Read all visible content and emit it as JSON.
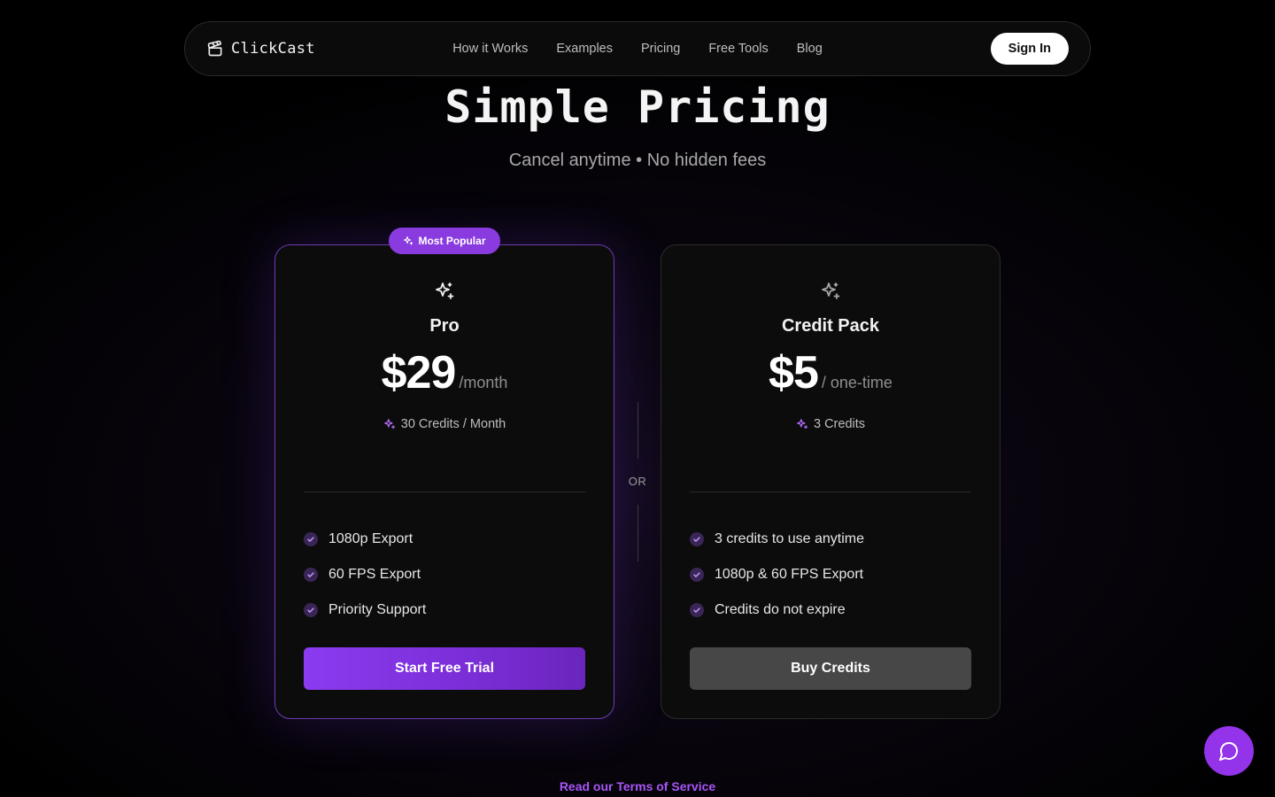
{
  "nav": {
    "brand": "ClickCast",
    "brand_icon": "clapperboard-icon",
    "links": [
      "How it Works",
      "Examples",
      "Pricing",
      "Free Tools",
      "Blog"
    ],
    "signin_label": "Sign In"
  },
  "hero": {
    "title": "Simple Pricing",
    "subtitle": "Cancel anytime • No hidden fees"
  },
  "plans": [
    {
      "badge": "Most Popular",
      "icon": "sparkles-icon",
      "name": "Pro",
      "price": "$29",
      "period": "/month",
      "credits": "30 Credits / Month",
      "features": [
        "1080p Export",
        "60 FPS Export",
        "Priority Support"
      ],
      "cta": "Start Free Trial"
    },
    {
      "icon": "sparkles-icon",
      "name": "Credit Pack",
      "price": "$5",
      "period": "/ one-time",
      "credits": "3 Credits",
      "features": [
        "3 credits to use anytime",
        "1080p & 60 FPS Export",
        "Credits do not expire"
      ],
      "cta": "Buy Credits"
    }
  ],
  "separator": "OR",
  "terms_link": "Read our Terms of Service",
  "chat_icon": "chat-bubble-icon",
  "colors": {
    "accent": "#8b3bf0",
    "accent_text": "#a855f7",
    "background": "#000000",
    "card_bg": "#0c0c0c",
    "secondary_button": "#474747"
  }
}
